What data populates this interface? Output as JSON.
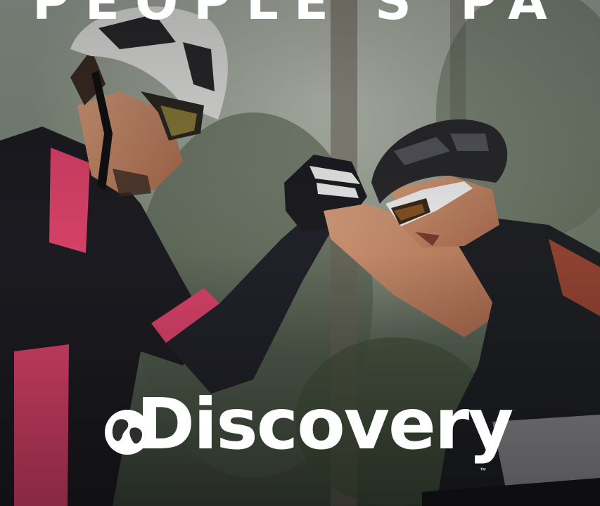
{
  "title": "PEOPLE'S PA",
  "logo": {
    "wordmark": "Discovery",
    "trademark": "™"
  },
  "colors": {
    "jersey_pink": "#e0446c",
    "jersey_black": "#1c1c22",
    "text_white": "#ffffff"
  }
}
